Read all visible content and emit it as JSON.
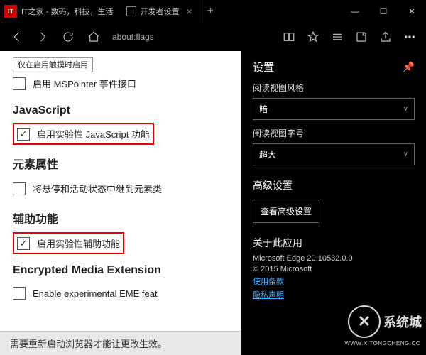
{
  "titlebar": {
    "badge": "IT",
    "site_text": "IT之家 - 数码，科技，生活",
    "tab_title": "开发者设置",
    "min": "—",
    "max": "☐",
    "close": "✕",
    "newtab": "+",
    "tabclose": "×"
  },
  "nav": {
    "url": "about:flags"
  },
  "flags": {
    "row0": "仅在启用触摸时启用",
    "mspointer": "启用 MSPointer 事件接口",
    "sec_js": "JavaScript",
    "js_exp": "启用实验性 JavaScript 功能",
    "sec_elem": "元素属性",
    "elem_item": "将悬停和活动状态中继到元素类",
    "sec_acc": "辅助功能",
    "acc_exp": "启用实验性辅助功能",
    "sec_eme": "Encrypted Media Extension",
    "eme_item": "Enable experimental EME feat"
  },
  "banner": {
    "text": "需要重新启动浏览器才能让更改生效。"
  },
  "settings": {
    "title": "设置",
    "label_style": "阅读视图风格",
    "value_style": "暗",
    "label_size": "阅读视图字号",
    "value_size": "超大",
    "sec_adv": "高级设置",
    "btn_adv": "查看高级设置",
    "sec_about": "关于此应用",
    "version": "Microsoft Edge 20.10532.0.0",
    "copyright": "© 2015 Microsoft",
    "link_terms": "使用条款",
    "link_privacy": "隐私声明"
  },
  "watermark": {
    "logo": "✕",
    "text": "系统城",
    "sub": "WWW.XITONGCHENG.CC"
  }
}
